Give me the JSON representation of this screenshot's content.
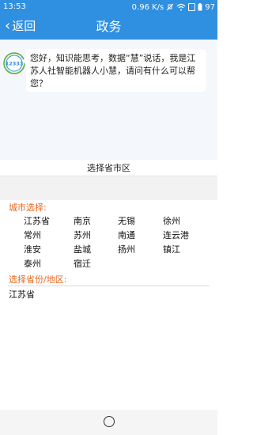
{
  "status_bar": {
    "time": "13:53",
    "net_speed": "0.96 K/s",
    "battery": "97"
  },
  "header": {
    "back_label": "返回",
    "title": "政务"
  },
  "chat": {
    "avatar_text": "12333",
    "message": "您好，知识能思考，数据“慧”说话，我是江苏人社智能机器人小慧，请问有什么可以帮您？"
  },
  "selector": {
    "title": "选择省市区",
    "city_label": "城市选择:",
    "cities": [
      "江苏省",
      "南京",
      "无锡",
      "徐州",
      "常州",
      "苏州",
      "南通",
      "连云港",
      "淮安",
      "盐城",
      "扬州",
      "镇江",
      "泰州",
      "宿迁"
    ],
    "province_label": "选择省份/地区:",
    "province_value": "江苏省"
  },
  "colors": {
    "accent": "#2f8fe0",
    "label": "#e8661e"
  }
}
